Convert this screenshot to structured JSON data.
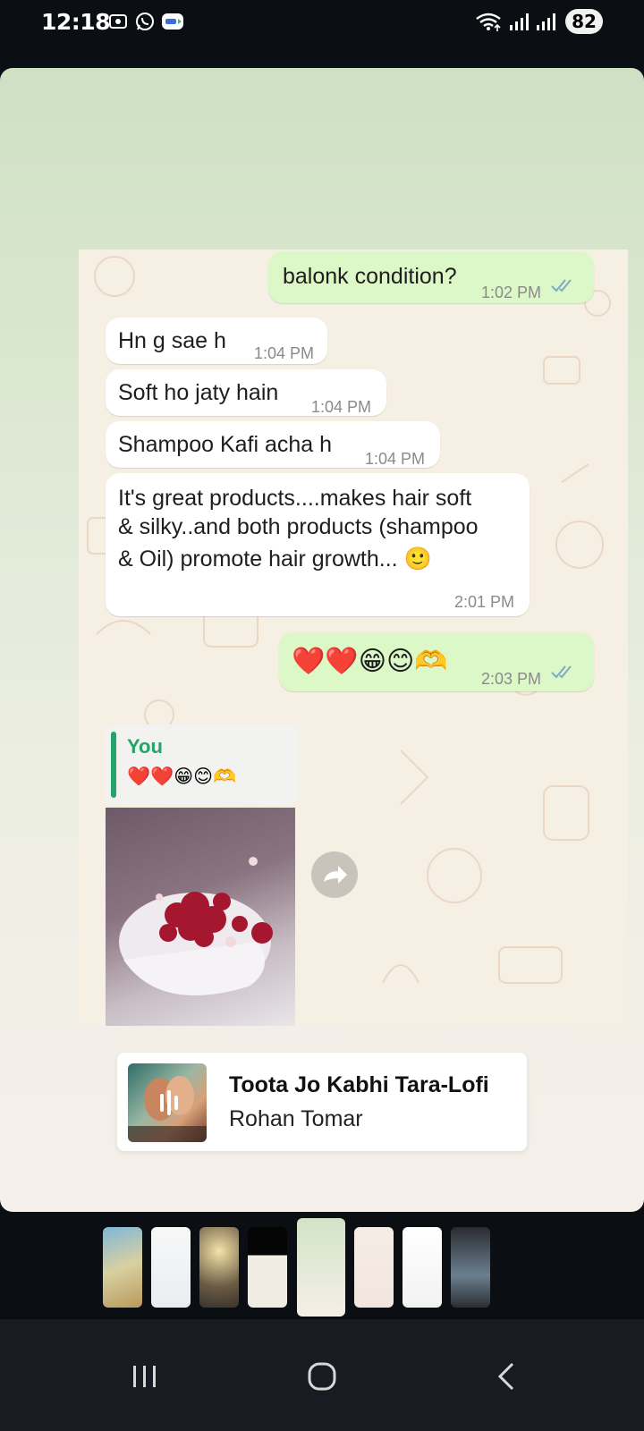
{
  "status_bar": {
    "time": "12:18",
    "battery": "82",
    "icons": [
      "screen-recorder-icon",
      "whatsapp-icon",
      "live-icon",
      "wifi-icon",
      "signal-icon",
      "signal-icon"
    ]
  },
  "chat": {
    "messages": [
      {
        "direction": "out",
        "text": "balonk condition?",
        "time": "1:02 PM",
        "read": true
      },
      {
        "direction": "in",
        "text": "Hn g sae h",
        "time": "1:04 PM"
      },
      {
        "direction": "in",
        "text": "Soft ho jaty hain",
        "time": "1:04 PM"
      },
      {
        "direction": "in",
        "text": "Shampoo Kafi acha h",
        "time": "1:04 PM"
      },
      {
        "direction": "in",
        "lines": [
          "It's great products....makes hair soft",
          "& silky..and both products (shampoo",
          "& Oil) promote hair growth... 🙂"
        ],
        "time": "2:01 PM"
      },
      {
        "direction": "out",
        "text": "❤️❤️😁😊🫶",
        "time": "2:03 PM",
        "read": true
      }
    ],
    "reply": {
      "name": "You",
      "text": "❤️❤️😁😊🫶"
    }
  },
  "music": {
    "title": "Toota Jo Kabhi Tara-Lofi",
    "artist": "Rohan Tomar"
  },
  "colors": {
    "accent_green": "#25a36b",
    "outgoing_bubble": "#dcf8c6",
    "incoming_bubble": "#ffffff",
    "read_ticks": "#7fa9c4"
  },
  "thumbnails": {
    "count": 8,
    "active_index": 4
  },
  "nav": {
    "buttons": [
      "recent-apps-icon",
      "home-icon",
      "back-icon"
    ]
  }
}
